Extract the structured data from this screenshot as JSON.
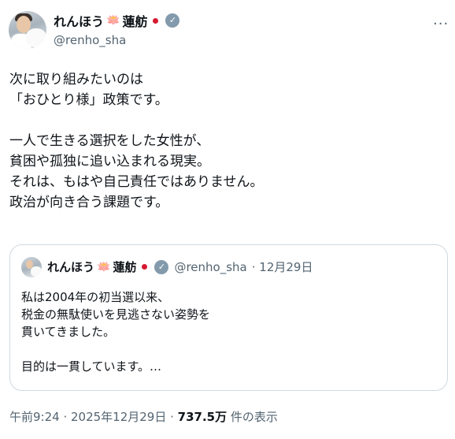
{
  "author": {
    "name": "れんほう",
    "name_emoji": "🪷",
    "name2": "蓮舫",
    "handle": "@renho_sha"
  },
  "tweet": {
    "lines_a": [
      "次に取り組みたいのは",
      "「おひとり様」政策です。"
    ],
    "lines_b": [
      "一人で生きる選択をした女性が、",
      "貧困や孤独に追い込まれる現実。",
      "それは、もはや自己責任ではありません。",
      "政治が向き合う課題です。"
    ]
  },
  "quoted": {
    "name": "れんほう",
    "name2": "蓮舫",
    "handle": "@renho_sha",
    "date": "· 12月29日",
    "lines_a": [
      "私は2004年の初当選以来、",
      "税金の無駄使いを見逃さない姿勢を",
      "貫いてきました。"
    ],
    "line_b": "目的は一貫しています。…"
  },
  "meta": {
    "time": "午前9:24 · 2025年12月29日 · ",
    "views": "737.5万",
    "views_suffix": " 件の表示"
  },
  "icons": {
    "more": "more-options-icon",
    "verified": "verified-badge-icon",
    "flag": "japan-flag-icon",
    "lotus": "lotus-icon"
  },
  "colors": {
    "text": "#0f1419",
    "secondary": "#536471",
    "verified_badge": "#829aab",
    "border": "#cfd9de",
    "flag_red": "#d61a2f"
  }
}
